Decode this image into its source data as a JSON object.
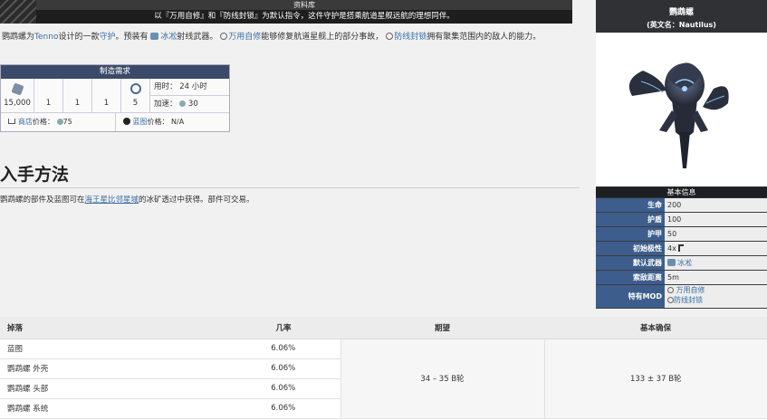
{
  "banner": {
    "title": "资料库",
    "subtitle": "以『万用自修』和『防线封锁』为默认指令，这件守护是搭乘航道星舰远航的理想同伴。"
  },
  "intro": {
    "name": "鹦鹉螺",
    "t1": "为",
    "tenno": "Tenno",
    "t2": "设计的一款",
    "guard": "守护",
    "t3": "。预装有",
    "weapon": "冰凇",
    "t4": "射线武器。",
    "mod1": "万用自修",
    "t5": "能够修复航道星舰上的部分事故，",
    "mod2": "防线封锁",
    "t6": "拥有聚集范围内的敌人的能力。"
  },
  "craft": {
    "header_pre": "制造",
    "header_link": "需求",
    "credits": "15,000",
    "r1": "1",
    "r2": "1",
    "r3": "1",
    "r4": "5",
    "time_label": "用时：",
    "time_value": "24 小时",
    "rush_label": "加速：",
    "rush_value": "30",
    "market_link": "商店",
    "market_label": "价格：",
    "market_value": "75",
    "bp_link": "蓝图",
    "bp_label": "价格：",
    "bp_value": "N/A"
  },
  "acquisition": {
    "heading": "入手方法",
    "text_pre": "鹦鹉螺的部件及蓝图可在",
    "link": "海王星比邻星域",
    "text_post": "的冰矿透过中获得。部件可交易。"
  },
  "infobox": {
    "name": "鹦鹉螺",
    "en_name": "(英文名：Nautilus)",
    "section": "基本信息",
    "rows": [
      {
        "k": "生命",
        "v": "200"
      },
      {
        "k": "护盾",
        "v": "100"
      },
      {
        "k": "护甲",
        "v": "50"
      },
      {
        "k": "初始极性",
        "v": "4x"
      },
      {
        "k": "默认武器",
        "v": "冰凇"
      },
      {
        "k": "索敌距离",
        "v": "5m"
      },
      {
        "k": "特有MOD",
        "v1": "万用自修",
        "v2": "防线封锁"
      }
    ]
  },
  "drops": {
    "headers": [
      "掉落",
      "几率",
      "期望",
      "基本确保"
    ],
    "rows": [
      {
        "item": "蓝图",
        "chance": "6.06%"
      },
      {
        "item": "鹦鹉螺 外壳",
        "chance": "6.06%"
      },
      {
        "item": "鹦鹉螺 头部",
        "chance": "6.06%"
      },
      {
        "item": "鹦鹉螺 系统",
        "chance": "6.06%"
      }
    ],
    "expected": "34 – 35 B轮",
    "guaranteed": "133 ± 37 B轮"
  },
  "colors": {
    "infobox_bg": "#2f3135",
    "infobox_key": "#3d5e8c",
    "link": "#3a6ea5",
    "craft_header": "#3b4a6b"
  }
}
